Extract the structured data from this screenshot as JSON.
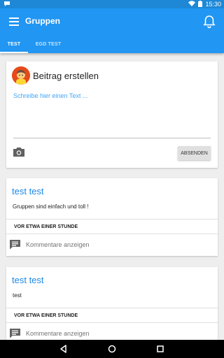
{
  "status_bar": {
    "time": "15:30"
  },
  "app_bar": {
    "title": "Gruppen"
  },
  "tabs": [
    {
      "label": "TEST",
      "active": true
    },
    {
      "label": "EGD TEST",
      "active": false
    }
  ],
  "composer": {
    "title": "Beitrag erstellen",
    "placeholder": "Schreibe hier einen Text ...",
    "send_label": "ABSENDEN"
  },
  "posts": [
    {
      "title": "test test",
      "text": "Gruppen sind einfach und toll !",
      "time": "VOR ETWA EINER STUNDE",
      "comments_label": "Kommentare anzeigen"
    },
    {
      "title": "test test",
      "text": "test",
      "time": "VOR ETWA EINER STUNDE",
      "comments_label": "Kommentare anzeigen"
    }
  ],
  "colors": {
    "primary": "#2196f3",
    "status_bar": "#1e88d6",
    "accent_text": "#1e88e5"
  },
  "icons": [
    "notification-icon",
    "wifi-icon",
    "battery-icon",
    "menu-icon",
    "bell-icon",
    "camera-icon",
    "comment-icon",
    "back-icon",
    "home-icon",
    "recents-icon"
  ]
}
